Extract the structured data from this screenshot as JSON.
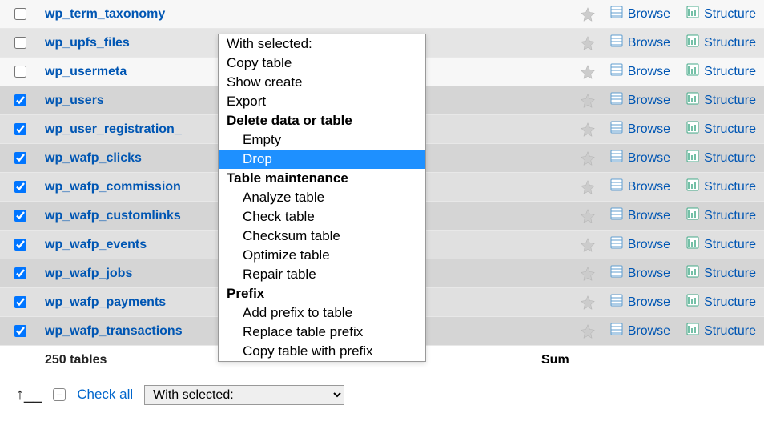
{
  "tables": [
    {
      "name": "wp_term_taxonomy",
      "checked": false
    },
    {
      "name": "wp_upfs_files",
      "checked": false
    },
    {
      "name": "wp_usermeta",
      "checked": false
    },
    {
      "name": "wp_users",
      "checked": true
    },
    {
      "name": "wp_user_registration_",
      "checked": true
    },
    {
      "name": "wp_wafp_clicks",
      "checked": true
    },
    {
      "name": "wp_wafp_commission",
      "checked": true
    },
    {
      "name": "wp_wafp_customlinks",
      "checked": true
    },
    {
      "name": "wp_wafp_events",
      "checked": true
    },
    {
      "name": "wp_wafp_jobs",
      "checked": true
    },
    {
      "name": "wp_wafp_payments",
      "checked": true
    },
    {
      "name": "wp_wafp_transactions",
      "checked": true
    }
  ],
  "actions": {
    "browse": "Browse",
    "structure": "Structure"
  },
  "summary": {
    "count": "250 tables",
    "sum": "Sum"
  },
  "footer": {
    "check_all": "Check all",
    "select_label": "With selected:"
  },
  "dropdown": [
    {
      "text": "With selected:",
      "bold": false,
      "indent": false,
      "header": true
    },
    {
      "text": "Copy table",
      "bold": false,
      "indent": false
    },
    {
      "text": "Show create",
      "bold": false,
      "indent": false
    },
    {
      "text": "Export",
      "bold": false,
      "indent": false
    },
    {
      "text": "Delete data or table",
      "bold": true,
      "indent": false,
      "header": true
    },
    {
      "text": "Empty",
      "bold": false,
      "indent": true
    },
    {
      "text": "Drop",
      "bold": false,
      "indent": true,
      "hover": true
    },
    {
      "text": "Table maintenance",
      "bold": true,
      "indent": false,
      "header": true
    },
    {
      "text": "Analyze table",
      "bold": false,
      "indent": true
    },
    {
      "text": "Check table",
      "bold": false,
      "indent": true
    },
    {
      "text": "Checksum table",
      "bold": false,
      "indent": true
    },
    {
      "text": "Optimize table",
      "bold": false,
      "indent": true
    },
    {
      "text": "Repair table",
      "bold": false,
      "indent": true
    },
    {
      "text": "Prefix",
      "bold": true,
      "indent": false,
      "header": true
    },
    {
      "text": "Add prefix to table",
      "bold": false,
      "indent": true
    },
    {
      "text": "Replace table prefix",
      "bold": false,
      "indent": true
    },
    {
      "text": "Copy table with prefix",
      "bold": false,
      "indent": true
    }
  ]
}
